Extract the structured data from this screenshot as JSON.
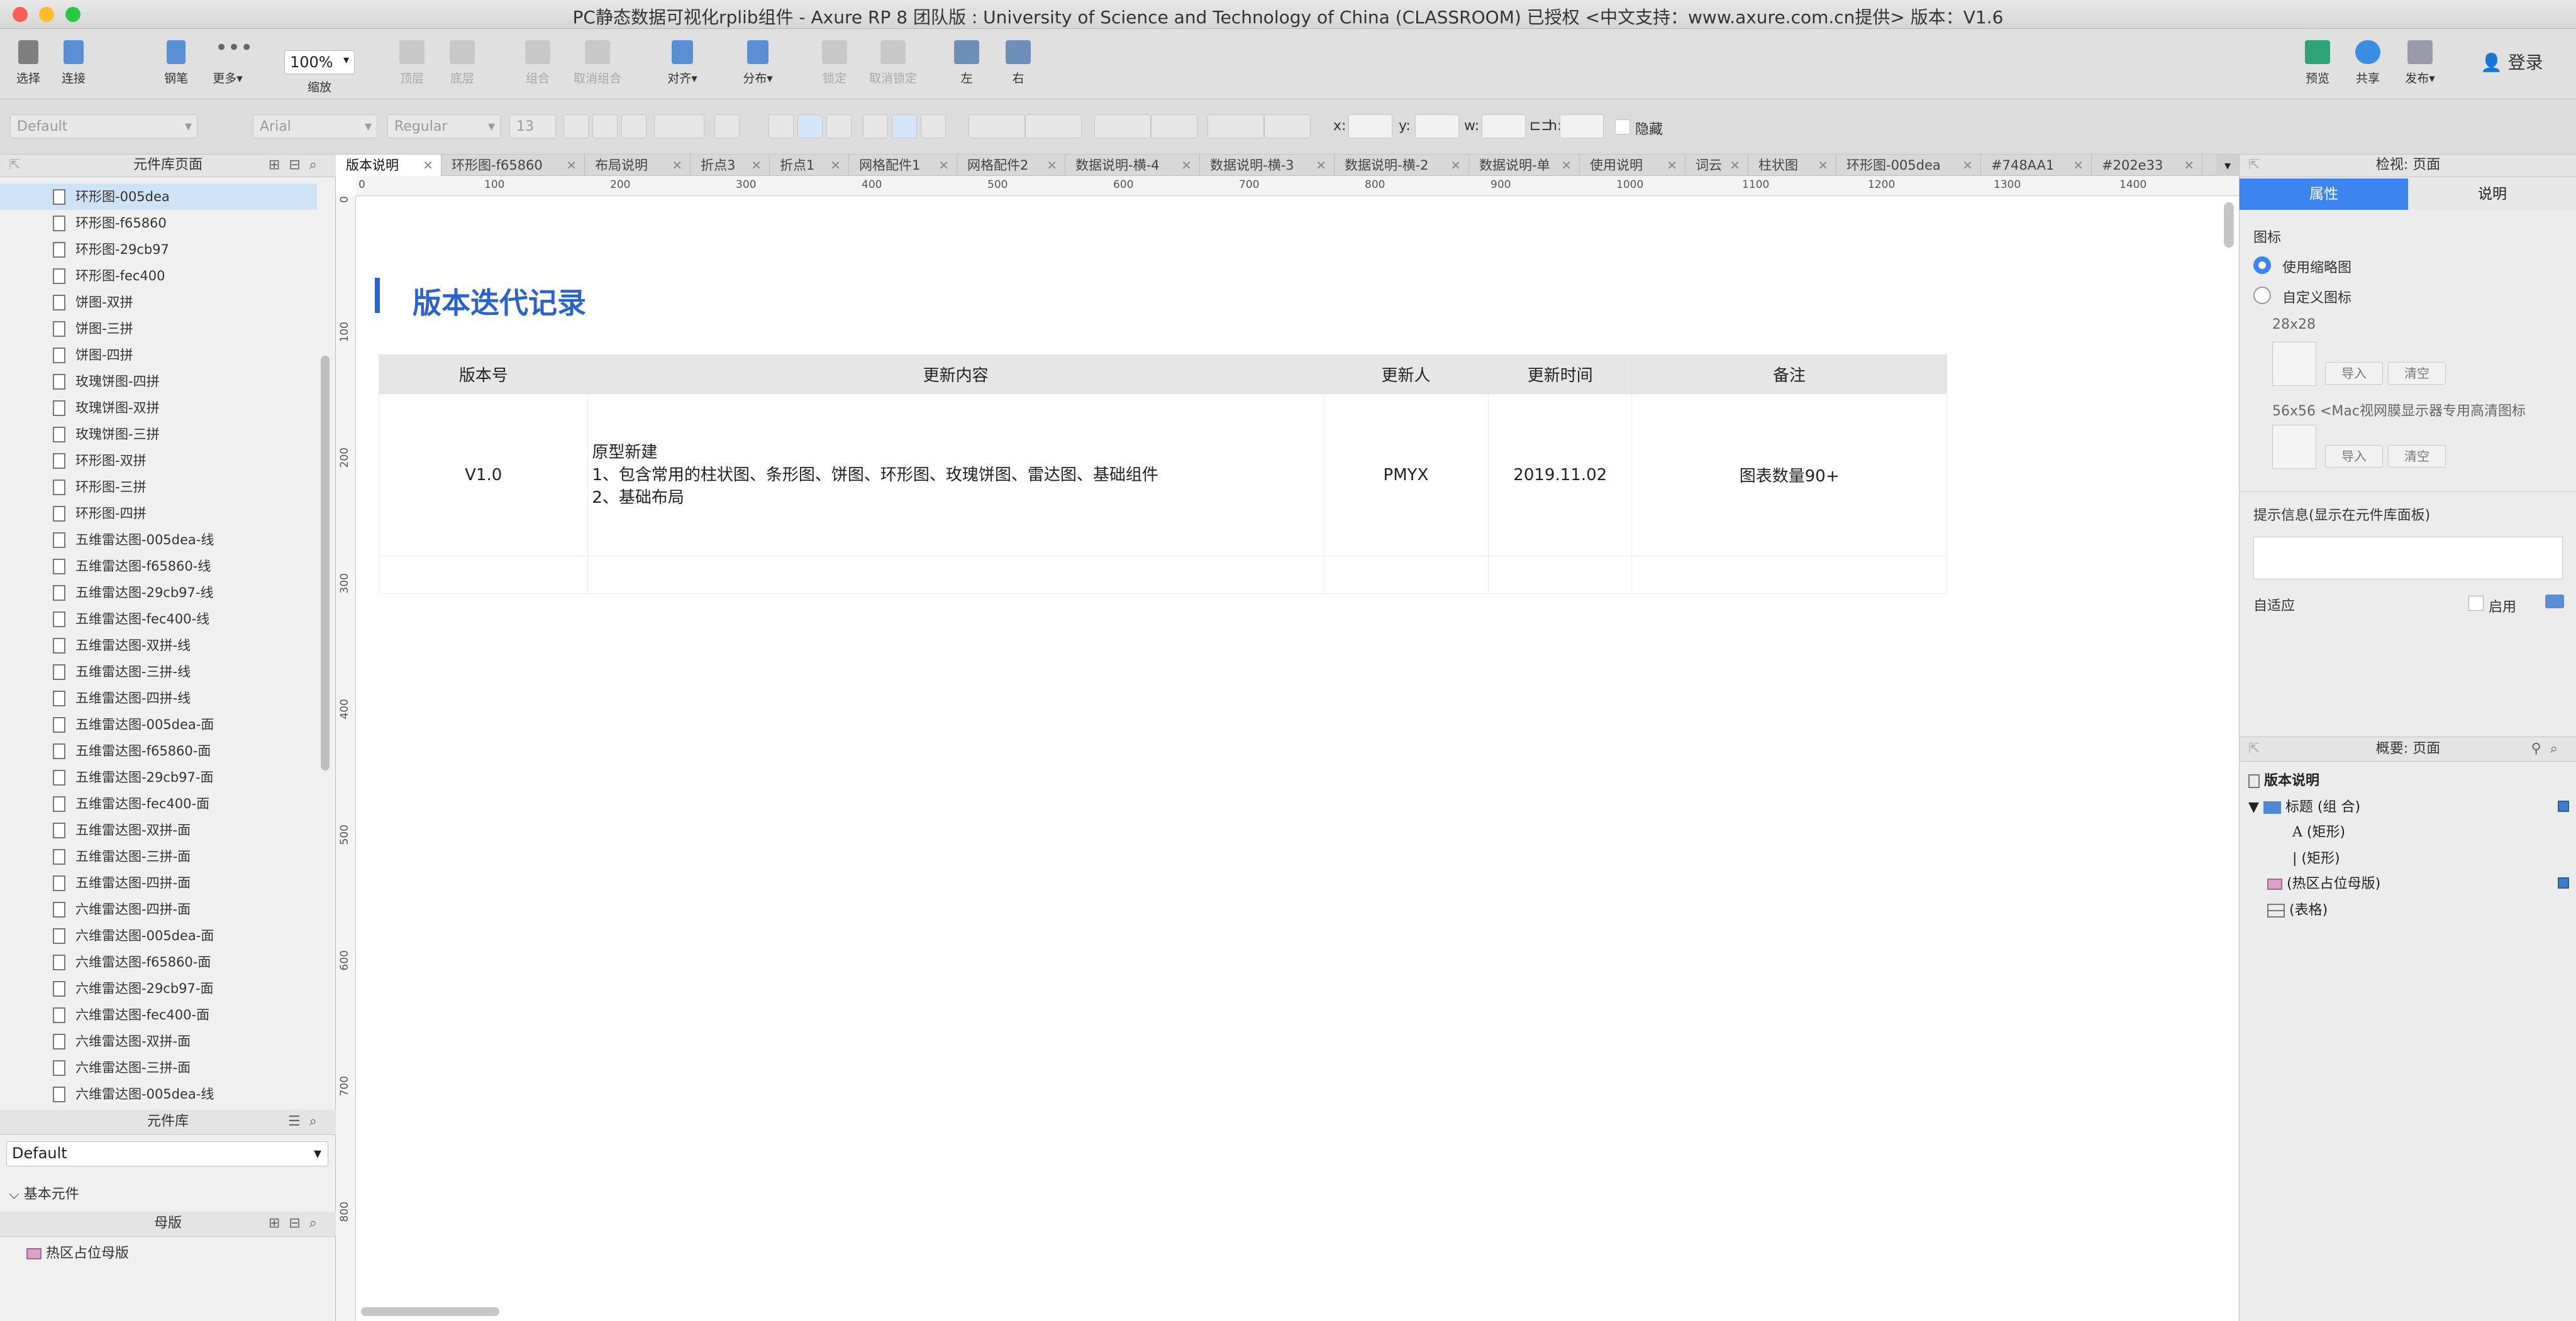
{
  "window": {
    "title": "PC静态数据可视化rplib组件 - Axure RP 8 团队版 : University of Science and Technology of China (CLASSROOM)  已授权     <中文支持：www.axure.com.cn提供> 版本：V1.6"
  },
  "toolbar": {
    "select": "选择",
    "connect": "连接",
    "pen": "钢笔",
    "more": "更多▾",
    "zoom_value": "100%",
    "zoom_label": "缩放",
    "top_layer": "顶层",
    "bottom_layer": "底层",
    "group": "组合",
    "ungroup": "取消组合",
    "align": "对齐▾",
    "distribute": "分布▾",
    "lock": "锁定",
    "unlock": "取消锁定",
    "left": "左",
    "right": "右",
    "preview": "预览",
    "share": "共享",
    "publish": "发布▾",
    "login": "登录"
  },
  "formatbar": {
    "style": "Default",
    "font": "Arial",
    "weight": "Regular",
    "size": "13",
    "x_label": "x:",
    "y_label": "y:",
    "w_label": "w:",
    "h_label": "h:",
    "hide_label": "隐藏"
  },
  "pages_panel": {
    "title": "元件库页面",
    "items": [
      "环形图-005dea",
      "环形图-f65860",
      "环形图-29cb97",
      "环形图-fec400",
      "饼图-双拼",
      "饼图-三拼",
      "饼图-四拼",
      "玫瑰饼图-四拼",
      "玫瑰饼图-双拼",
      "玫瑰饼图-三拼",
      "环形图-双拼",
      "环形图-三拼",
      "环形图-四拼",
      "五维雷达图-005dea-线",
      "五维雷达图-f65860-线",
      "五维雷达图-29cb97-线",
      "五维雷达图-fec400-线",
      "五维雷达图-双拼-线",
      "五维雷达图-三拼-线",
      "五维雷达图-四拼-线",
      "五维雷达图-005dea-面",
      "五维雷达图-f65860-面",
      "五维雷达图-29cb97-面",
      "五维雷达图-fec400-面",
      "五维雷达图-双拼-面",
      "五维雷达图-三拼-面",
      "五维雷达图-四拼-面",
      "六维雷达图-四拼-面",
      "六维雷达图-005dea-面",
      "六维雷达图-f65860-面",
      "六维雷达图-29cb97-面",
      "六维雷达图-fec400-面",
      "六维雷达图-双拼-面",
      "六维雷达图-三拼-面",
      "六维雷达图-005dea-线"
    ]
  },
  "library_panel": {
    "title": "元件库",
    "selected": "Default",
    "group": "基本元件"
  },
  "masters_panel": {
    "title": "母版",
    "item": "热区占位母版"
  },
  "tabs": [
    "版本说明",
    "环形图-f65860",
    "布局说明",
    "折点3",
    "折点1",
    "网格配件1",
    "网格配件2",
    "数据说明-横-4",
    "数据说明-横-3",
    "数据说明-横-2",
    "数据说明-单",
    "使用说明",
    "词云",
    "柱状图",
    "环形图-005dea",
    "#748AA1",
    "#202e33"
  ],
  "ruler": {
    "h": [
      "0",
      "100",
      "200",
      "300",
      "400",
      "500",
      "600",
      "700",
      "800",
      "900",
      "1000",
      "1100",
      "1200",
      "1300",
      "1400"
    ],
    "v": [
      "0",
      "100",
      "200",
      "300",
      "400",
      "500",
      "600",
      "700",
      "800"
    ]
  },
  "page": {
    "heading": "版本迭代记录",
    "table": {
      "headers": [
        "版本号",
        "更新内容",
        "更新人",
        "更新时间",
        "备注"
      ],
      "row": {
        "version": "V1.0",
        "content_1": "原型新建",
        "content_2": "1、包含常用的柱状图、条形图、饼图、环形图、玫瑰饼图、雷达图、基础组件",
        "content_3": "2、基础布局",
        "author": "PMYX",
        "date": "2019.11.02",
        "note": "图表数量90+"
      }
    }
  },
  "inspector": {
    "title": "检视: 页面",
    "tab_props": "属性",
    "tab_notes": "说明",
    "icon_label": "图标",
    "opt_thumb": "使用缩略图",
    "opt_custom": "自定义图标",
    "size_28": "28x28",
    "size_56": "56x56 <Mac视网膜显示器专用高清图标",
    "import": "导入",
    "clear": "清空",
    "tooltip_label": "提示信息(显示在元件库面板)",
    "adaptive_label": "自适应",
    "enable": "启用"
  },
  "outline": {
    "title": "概要: 页面",
    "root": "版本说明",
    "group": "标题 (组 合)",
    "rect1": "(矩形)",
    "rect2": "(矩形)",
    "master": "(热区占位母版)",
    "table": "(表格)"
  },
  "colors": {
    "accent": "#2c63c8",
    "selected_tab": "#3d84f0"
  }
}
